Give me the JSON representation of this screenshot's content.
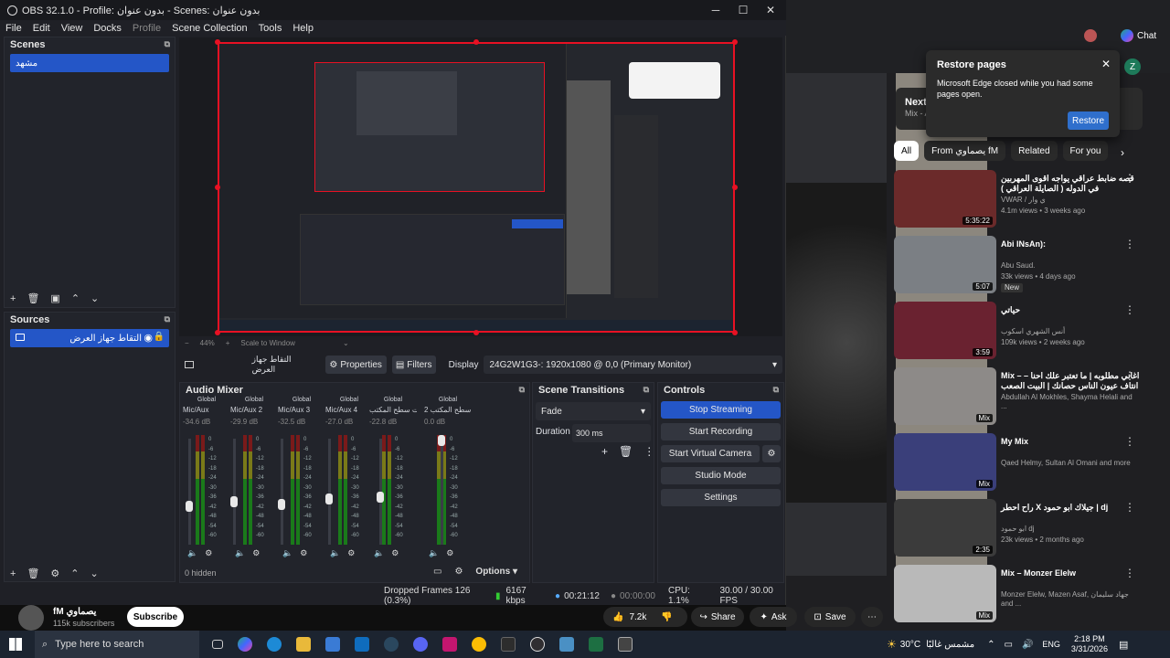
{
  "obs": {
    "title": "OBS 32.1.0 - Profile: بدون عنوان - Scenes: بدون عنوان",
    "menu": [
      "File",
      "Edit",
      "View",
      "Docks",
      "Profile",
      "Scene Collection",
      "Tools",
      "Help"
    ],
    "scenes": {
      "title": "Scenes",
      "items": [
        "مشهد"
      ]
    },
    "sources": {
      "title": "Sources",
      "items": [
        "التقاط جهاز العرض"
      ]
    },
    "zoom_label": "44%",
    "scale_label": "Scale to Window",
    "context": {
      "source_name": "التقاط جهاز العرض",
      "properties": "Properties",
      "filters": "Filters",
      "display_label": "Display",
      "display_value": "24G2W1G3-: 1920x1080 @ 0,0 (Primary Monitor)"
    },
    "audio_mixer": {
      "title": "Audio Mixer",
      "hidden": "0 hidden",
      "channels": [
        {
          "scope": "Global",
          "name": "Mic/Aux",
          "db": "-34.6 dB"
        },
        {
          "scope": "Global",
          "name": "Mic/Aux 2",
          "db": "-29.9 dB"
        },
        {
          "scope": "Global",
          "name": "Mic/Aux 3",
          "db": "-32.5 dB"
        },
        {
          "scope": "Global",
          "name": "Mic/Aux 4",
          "db": "-27.0 dB"
        },
        {
          "scope": "Global",
          "name": "صوت سطح المكتب",
          "db": "-22.8 dB"
        },
        {
          "scope": "Global",
          "name": "صوت سطح المكتب 2",
          "db": "0.0 dB"
        }
      ],
      "scale": [
        "0",
        "-6",
        "-12",
        "-18",
        "-24",
        "-30",
        "-36",
        "-42",
        "-48",
        "-54",
        "-60"
      ]
    },
    "transitions": {
      "title": "Scene Transitions",
      "value": "Fade",
      "duration_label": "Duration",
      "duration_value": "300 ms"
    },
    "controls": {
      "title": "Controls",
      "stop_streaming": "Stop Streaming",
      "start_recording": "Start Recording",
      "start_virtual_camera": "Start Virtual Camera",
      "studio_mode": "Studio Mode",
      "settings": "Settings"
    },
    "options_label": "Options",
    "status": {
      "dropped": "Dropped Frames 126 (0.3%)",
      "kbps": "6167 kbps",
      "stream_time": "00:21:12",
      "rec_time": "00:00:00",
      "cpu": "CPU: 1.1%",
      "fps": "30.00 / 30.00 FPS"
    }
  },
  "youtube": {
    "channel_name": "fM يصماوي",
    "subscribers": "115k subscribers",
    "subscribe": "Subscribe",
    "likes": "7.2k",
    "share": "Share",
    "ask": "Ask",
    "save": "Save",
    "next_label": "Next:",
    "next_sub": "Mix - A",
    "chips": [
      "All",
      "From يصماوي fM",
      "Related",
      "For you"
    ],
    "videos": [
      {
        "title": "قصه ضابط عراقي يواجه اقوى المهربين في الدوله ( الصايلة العراقي )",
        "channel": "VWAR / ي وار",
        "meta": "4.1m views • 3 weeks ago",
        "badge": "",
        "duration": "5:35:22"
      },
      {
        "title": "Abi INsAn):",
        "channel": "Abu Saud.",
        "meta": "33k views • 4 days ago",
        "badge": "New",
        "duration": "5:07"
      },
      {
        "title": "حياتي",
        "channel": "أنس الشهري اسكوب",
        "meta": "109k views • 2 weeks ago",
        "badge": "",
        "duration": "3:59"
      },
      {
        "title": "Mix – اغاني مطلوبه | ما تعتبر علك احنا – انتاف عيون الناس حصانك | البيت الصعب",
        "channel": "Abdullah Al Mokhles, Shayma Helali and ...",
        "meta": "",
        "badge": "",
        "duration": "Mix"
      },
      {
        "title": "My Mix",
        "channel": "Qaed Helmy, Sultan Al Omani and more",
        "meta": "",
        "badge": "",
        "duration": "Mix"
      },
      {
        "title": "راح احطر X جيلاك ابو حمود | dj",
        "channel": "ابو حمود dj",
        "meta": "23k views • 2 months ago",
        "badge": "",
        "duration": "2:35"
      },
      {
        "title": "Mix – Monzer Elelw",
        "channel": "Monzer Elelw, Mazen Asaf, جهاد سليمان and ...",
        "meta": "",
        "badge": "",
        "duration": "Mix"
      }
    ]
  },
  "edge_popup": {
    "title": "Restore pages",
    "body": "Microsoft Edge closed while you had some pages open.",
    "restore": "Restore",
    "chat": "Chat"
  },
  "taskbar": {
    "search_placeholder": "Type here to search",
    "weather": "30°C",
    "weather_desc": "مشمس غالبًا",
    "lang": "ENG",
    "time": "2:18 PM",
    "date": "3/31/2026"
  }
}
